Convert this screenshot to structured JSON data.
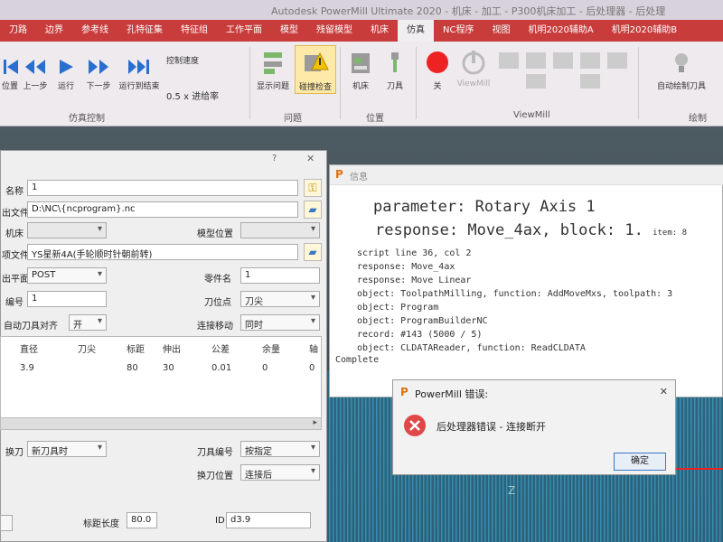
{
  "window": {
    "title": "Autodesk PowerMill Ultimate 2020 - 机床 - 加工 - P300机床加工 - 后处理器 - 后处理"
  },
  "tabs": [
    "刀路",
    "边界",
    "参考线",
    "孔特征集",
    "特征组",
    "工作平面",
    "模型",
    "残留模型",
    "机床",
    "仿真",
    "NC程序",
    "视图",
    "机明2020辅助A",
    "机明2020辅助B"
  ],
  "active_tab_index": 9,
  "ribbon": {
    "sim_control": {
      "buttons": [
        "位置",
        "上一步",
        "运行",
        "下一步",
        "运行到结束"
      ],
      "speed_label": "控制速度",
      "rate_label": "0.5 x 进给率",
      "group_label": "仿真控制"
    },
    "problems": {
      "buttons": [
        "显示问题",
        "碰撞检查"
      ],
      "group_label": "问题"
    },
    "position": {
      "buttons": [
        "机床",
        "刀具"
      ],
      "group_label": "位置"
    },
    "viewmill": {
      "buttons": [
        "关",
        "ViewMill"
      ],
      "group_label": "ViewMill"
    },
    "draw": {
      "buttons": [
        "自动绘制刀具"
      ],
      "group_label": "绘制"
    }
  },
  "ncdialog": {
    "question_mark": "?",
    "close": "✕",
    "name_label": "名称",
    "name_value": "1",
    "output_file_label": "出文件",
    "output_file_value": "D:\\NC\\{ncprogram}.nc",
    "machine_label": "机床",
    "model_position_label": "模型位置",
    "postproc_label": "项文件",
    "postproc_value": "YS星新4A(手轮顺时针朝前转)",
    "workplane_label": "出平面",
    "workplane_value": "POST",
    "part_name_label": "零件名",
    "part_name_value": "1",
    "number_label": "编号",
    "number_value": "1",
    "tool_pos_label": "刀位点",
    "tool_pos_value": "刀尖",
    "auto_align_label": "自动刀具对齐",
    "auto_align_value": "开",
    "connect_label": "连接移动",
    "connect_value": "同时",
    "columns": [
      "直径",
      "刀尖",
      "标距",
      "伸出",
      "公差",
      "余量",
      "轴"
    ],
    "row": [
      "3.9",
      "",
      "80",
      "30",
      "0.01",
      "0",
      "0"
    ],
    "tool_change_label": "换刀",
    "tool_change_value": "新刀具时",
    "tool_number_label": "刀具编号",
    "tool_number_value": "按指定",
    "change_pos_label": "换刀位置",
    "change_pos_value": "连接后",
    "gauge_label": "标距长度",
    "gauge_value": "80.0",
    "id_label": "ID",
    "id_value": "d3.9"
  },
  "info": {
    "title": "信息",
    "line1": "parameter: Rotary Axis 1",
    "line2": "response: Move_4ax, block: 1.",
    "line2_suffix": "item: 8",
    "lines": [
      "script  line 36, col 2",
      "response: Move_4ax",
      "response: Move Linear",
      "object: ToolpathMilling, function: AddMoveMxs, toolpath: 3",
      "object: Program",
      "object: ProgramBuilderNC",
      "record: #143 (5000 / 5)",
      "object: CLDATAReader, function: ReadCLDATA"
    ],
    "complete": "Complete"
  },
  "error": {
    "title": "PowerMill 错误:",
    "message": "后处理器错误 - 连接断开",
    "ok": "确定",
    "close": "✕"
  },
  "viewport": {
    "axis_label": "Z"
  }
}
